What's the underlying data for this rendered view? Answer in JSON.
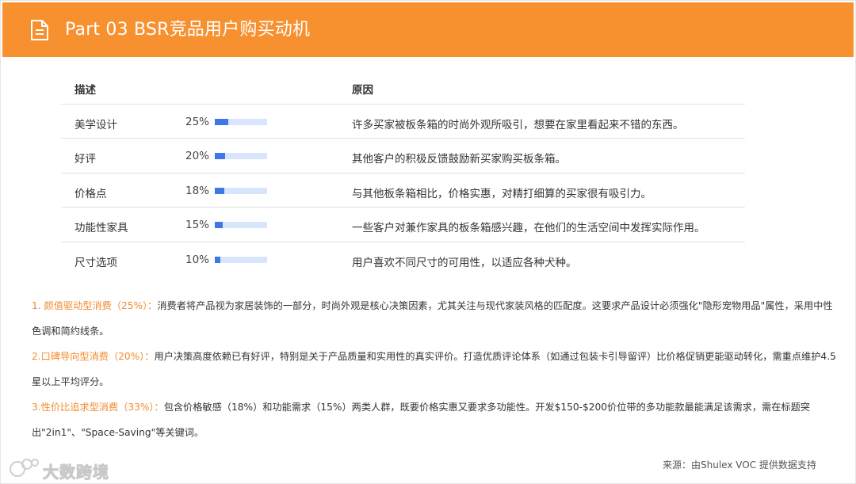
{
  "header": {
    "title": "Part 03  BSR竞品用户购买动机",
    "icon": "document-icon",
    "color": "#f79130"
  },
  "table": {
    "headers": {
      "desc": "描述",
      "reason": "原因"
    },
    "rows": [
      {
        "label": "美学设计",
        "pct_text": "25%",
        "pct": 25,
        "reason": "许多买家被板条箱的时尚外观所吸引，想要在家里看起来不错的东西。"
      },
      {
        "label": "好评",
        "pct_text": "20%",
        "pct": 20,
        "reason": "其他客户的积极反馈鼓励新买家购买板条箱。"
      },
      {
        "label": "价格点",
        "pct_text": "18%",
        "pct": 18,
        "reason": "与其他板条箱相比，价格实惠，对精打细算的买家很有吸引力。"
      },
      {
        "label": "功能性家具",
        "pct_text": "15%",
        "pct": 15,
        "reason": "一些客户对兼作家具的板条箱感兴趣，在他们的生活空间中发挥实际作用。"
      },
      {
        "label": "尺寸选项",
        "pct_text": "10%",
        "pct": 10,
        "reason": "用户喜欢不同尺寸的可用性，以适应各种犬种。"
      }
    ],
    "bar_color": "#3e78e8",
    "bar_track_color": "#d9e5fb"
  },
  "notes": [
    {
      "title": "1. 颜值驱动型消费（25%）：",
      "body": "消费者将产品视为家居装饰的一部分，时尚外观是核心决策因素，尤其关注与现代家装风格的匹配度。这要求产品设计必须强化\"隐形宠物用品\"属性，采用中性色调和简约线条。"
    },
    {
      "title": "2.口碑导向型消费（20%）：",
      "body": "用户决策高度依赖已有好评，特别是关于产品质量和实用性的真实评价。打造优质评论体系（如通过包装卡引导留评）比价格促销更能驱动转化，需重点维护4.5星以上平均评分。"
    },
    {
      "title": "3.性价比追求型消费（33%）：",
      "body": "包含价格敏感（18%）和功能需求（15%）两类人群，既要价格实惠又要求多功能性。开发$150-$200价位带的多功能款最能满足该需求，需在标题突出\"2in1\"、\"Space-Saving\"等关键词。"
    }
  ],
  "highlight_color": "#f28b2e",
  "footer": {
    "logo_text": "大数跨境",
    "source": "来源：由Shulex VOC 提供数据支持"
  }
}
